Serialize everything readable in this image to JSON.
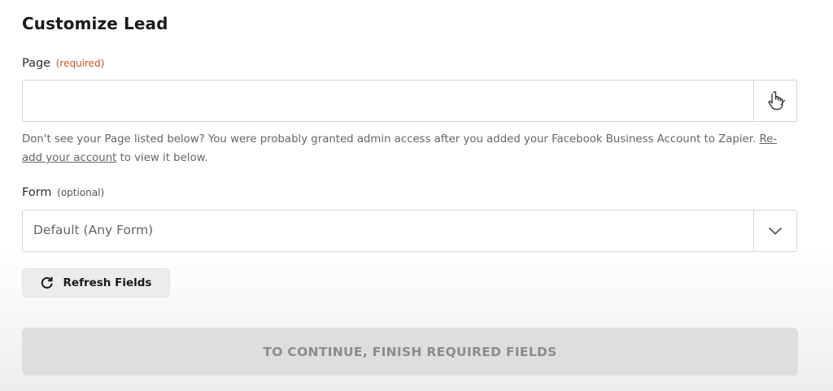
{
  "title": "Customize Lead",
  "page_field": {
    "label": "Page",
    "required_tag": "(required)",
    "value": "",
    "icon": "hand-pointer-icon"
  },
  "help": {
    "text_before": "Don't see your Page listed below? You were probably granted admin access after you added your Facebook Business Account to Zapier. ",
    "link": "Re-add your account",
    "text_after": " to view it below."
  },
  "form_field": {
    "label": "Form",
    "optional_tag": "(optional)",
    "value": "Default (Any Form)",
    "icon": "chevron-down-icon"
  },
  "refresh_button": {
    "label": "Refresh Fields",
    "icon": "refresh-icon"
  },
  "continue_button": {
    "label": "TO CONTINUE, FINISH REQUIRED FIELDS"
  },
  "colors": {
    "required": "#d4522a",
    "disabled_button_bg": "#dedede",
    "disabled_button_text": "#8c8c8c"
  }
}
